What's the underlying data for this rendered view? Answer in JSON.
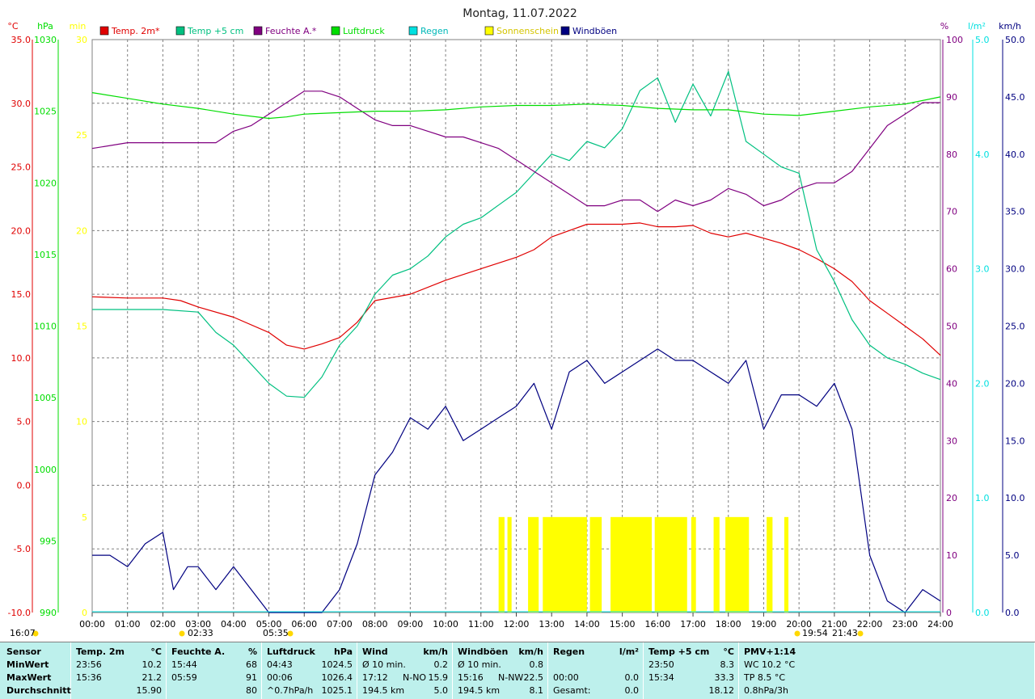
{
  "title": "Montag, 11.07.2022",
  "colors": {
    "temp": "#e00000",
    "temp5": "#00c080",
    "humidity": "#800080",
    "pressure": "#00dd00",
    "rain": "#00e0e0",
    "sun": "#ffff00",
    "gust": "#000080"
  },
  "axis_units": {
    "temp": "°C",
    "pressure": "hPa",
    "sun": "min",
    "humidity": "%",
    "rain": "l/m²",
    "wind": "km/h"
  },
  "legend": [
    {
      "label": "Temp. 2m*",
      "color": "#e00000"
    },
    {
      "label": "Temp +5 cm",
      "color": "#00c080"
    },
    {
      "label": "Feuchte A.*",
      "color": "#800080"
    },
    {
      "label": "Luftdruck",
      "color": "#00dd00"
    },
    {
      "label": "Regen",
      "color": "#00e0e0"
    },
    {
      "label": "Sonnenschein",
      "color": "#ffff00"
    },
    {
      "label": "Windböen",
      "color": "#000080"
    }
  ],
  "marks": {
    "sunrise": "05:35",
    "sunset": "21:43",
    "moonrise": "16:07",
    "moon_a": "02:33",
    "moon_b": "19:54"
  },
  "chart_data": {
    "type": "line",
    "x_label_ticks": [
      "00:00",
      "01:00",
      "02:00",
      "03:00",
      "04:00",
      "05:00",
      "06:00",
      "07:00",
      "08:00",
      "09:00",
      "10:00",
      "11:00",
      "12:00",
      "13:00",
      "14:00",
      "15:00",
      "16:00",
      "17:00",
      "18:00",
      "19:00",
      "20:00",
      "21:00",
      "22:00",
      "23:00",
      "24:00"
    ],
    "axes": {
      "temp": {
        "ticks": [
          "35.0",
          "30.0",
          "25.0",
          "20.0",
          "15.0",
          "10.0",
          "5.0",
          "0.0",
          "-5.0",
          "-10.0"
        ],
        "range": [
          -10,
          35
        ]
      },
      "pressure": {
        "ticks": [
          "1030",
          "1025",
          "1020",
          "1015",
          "1010",
          "1005",
          "1000",
          "995",
          "990"
        ],
        "range": [
          990,
          1030
        ]
      },
      "sun": {
        "ticks": [
          "30",
          "25",
          "20",
          "15",
          "10",
          "5",
          "0"
        ],
        "range": [
          0,
          30
        ]
      },
      "humidity": {
        "ticks": [
          "100",
          "90",
          "80",
          "70",
          "60",
          "50",
          "40",
          "30",
          "20",
          "10",
          "0"
        ],
        "range": [
          0,
          100
        ]
      },
      "rain": {
        "ticks": [
          "5.0",
          "4.0",
          "3.0",
          "2.0",
          "1.0",
          "0.0"
        ],
        "range": [
          0,
          5
        ]
      },
      "wind": {
        "ticks": [
          "50.0",
          "45.0",
          "40.0",
          "35.0",
          "30.0",
          "25.0",
          "20.0",
          "15.0",
          "10.0",
          "5.0",
          "0.0"
        ],
        "range": [
          0,
          50
        ]
      }
    },
    "series": [
      {
        "name": "Temp. 2m*",
        "unit": "°C",
        "x": [
          0,
          1,
          2,
          2.5,
          3,
          4,
          5,
          5.5,
          6,
          6.5,
          7,
          7.5,
          8,
          9,
          10,
          11,
          12,
          12.5,
          13,
          13.5,
          14,
          14.5,
          15,
          15.5,
          16,
          16.5,
          17,
          17.5,
          18,
          18.5,
          19,
          19.5,
          20,
          20.5,
          21,
          21.5,
          22,
          22.5,
          23,
          23.5,
          24
        ],
        "y": [
          14.8,
          14.7,
          14.7,
          14.5,
          14.0,
          13.2,
          12.0,
          11.0,
          10.7,
          11.1,
          11.6,
          12.8,
          14.5,
          15.0,
          16.1,
          17.0,
          17.9,
          18.5,
          19.5,
          20.0,
          20.5,
          20.5,
          20.5,
          20.6,
          20.3,
          20.3,
          20.4,
          19.8,
          19.5,
          19.8,
          19.4,
          19.0,
          18.5,
          17.8,
          17.0,
          16.0,
          14.5,
          13.5,
          12.5,
          11.5,
          10.2
        ]
      },
      {
        "name": "Temp +5 cm",
        "unit": "°C",
        "x": [
          0,
          1,
          2,
          3,
          3.5,
          4,
          4.5,
          5,
          5.5,
          6,
          6.5,
          7,
          7.5,
          8,
          8.5,
          9,
          9.5,
          10,
          10.5,
          11,
          11.5,
          12,
          12.5,
          13,
          13.5,
          14,
          14.5,
          15,
          15.5,
          16,
          16.5,
          17,
          17.5,
          18,
          18.5,
          19,
          19.5,
          20,
          20.5,
          21,
          21.5,
          22,
          22.5,
          23,
          23.5,
          24
        ],
        "y": [
          13.8,
          13.8,
          13.8,
          13.6,
          12.0,
          11.0,
          9.5,
          8.0,
          7.0,
          6.9,
          8.5,
          11.0,
          12.5,
          15.0,
          16.5,
          17.0,
          18.0,
          19.5,
          20.5,
          21.0,
          22.0,
          23.0,
          24.5,
          26.0,
          25.5,
          27.0,
          26.5,
          28.0,
          31.0,
          32.0,
          28.5,
          31.5,
          29.0,
          32.5,
          27.0,
          26.0,
          25.0,
          24.5,
          18.5,
          16.0,
          13.0,
          11.0,
          10.0,
          9.5,
          8.8,
          8.3
        ]
      },
      {
        "name": "Feuchte A.*",
        "unit": "%",
        "x": [
          0,
          1,
          1.5,
          2,
          3,
          3.5,
          4,
          4.5,
          5,
          5.5,
          6,
          6.5,
          7,
          7.5,
          8,
          8.5,
          9,
          9.5,
          10,
          10.5,
          11,
          11.5,
          12,
          12.5,
          13,
          13.5,
          14,
          14.5,
          15,
          15.5,
          16,
          16.5,
          17,
          17.5,
          18,
          18.5,
          19,
          19.5,
          20,
          20.5,
          21,
          21.5,
          22,
          22.5,
          23,
          23.5,
          24
        ],
        "y": [
          81,
          82,
          82,
          82,
          82,
          82,
          84,
          85,
          87,
          89,
          91,
          91,
          90,
          88,
          86,
          85,
          85,
          84,
          83,
          83,
          82,
          81,
          79,
          77,
          75,
          73,
          71,
          71,
          72,
          72,
          70,
          72,
          71,
          72,
          74,
          73,
          71,
          72,
          74,
          75,
          75,
          77,
          81,
          85,
          87,
          89,
          89
        ]
      },
      {
        "name": "Luftdruck",
        "unit": "hPa",
        "x": [
          0,
          1,
          2,
          3,
          4,
          5,
          5.5,
          6,
          7,
          8,
          9,
          10,
          11,
          12,
          13,
          14,
          15,
          16,
          17,
          18,
          19,
          20,
          21,
          22,
          23,
          24
        ],
        "y": [
          1026.3,
          1025.9,
          1025.5,
          1025.2,
          1024.8,
          1024.5,
          1024.6,
          1024.8,
          1024.9,
          1025.0,
          1025.0,
          1025.1,
          1025.3,
          1025.4,
          1025.4,
          1025.5,
          1025.4,
          1025.2,
          1025.1,
          1025.1,
          1024.8,
          1024.7,
          1025.0,
          1025.3,
          1025.5,
          1026.0
        ]
      },
      {
        "name": "Windböen",
        "unit": "km/h",
        "x": [
          0,
          0.5,
          1,
          1.5,
          2,
          2.3,
          2.7,
          3,
          3.5,
          4,
          4.5,
          5,
          5.5,
          6,
          6.5,
          7,
          7.5,
          8,
          8.5,
          9,
          9.5,
          10,
          10.5,
          11,
          11.5,
          12,
          12.5,
          13,
          13.5,
          14,
          14.5,
          15,
          15.5,
          16,
          16.5,
          17,
          17.5,
          18,
          18.5,
          19,
          19.5,
          20,
          20.5,
          21,
          21.5,
          22,
          22.5,
          23,
          23.5,
          24
        ],
        "y": [
          5,
          5,
          4,
          6,
          7,
          2,
          4,
          4,
          2,
          4,
          2,
          0,
          0,
          0,
          0,
          2,
          6,
          12,
          14,
          17,
          16,
          18,
          15,
          16,
          17,
          18,
          20,
          16,
          21,
          22,
          20,
          21,
          22,
          23,
          22,
          22,
          21,
          20,
          22,
          16,
          19,
          19,
          18,
          20,
          16,
          5,
          1,
          0,
          2,
          1
        ]
      }
    ],
    "sunshine_intervals": [
      [
        "11:30",
        "11:40"
      ],
      [
        "11:45",
        "11:52"
      ],
      [
        "12:20",
        "12:38"
      ],
      [
        "12:45",
        "14:00"
      ],
      [
        "14:05",
        "14:25"
      ],
      [
        "14:40",
        "15:50"
      ],
      [
        "15:55",
        "16:50"
      ],
      [
        "16:57",
        "17:05"
      ],
      [
        "17:35",
        "17:45"
      ],
      [
        "17:55",
        "18:35"
      ],
      [
        "19:05",
        "19:15"
      ],
      [
        "19:35",
        "19:42"
      ]
    ],
    "rain": {
      "values": [
        0
      ]
    }
  },
  "table": {
    "row_labels": [
      "Sensor",
      "MinWert",
      "MaxWert",
      "Durchschnitt"
    ],
    "sections": [
      {
        "header": "Temp. 2m",
        "unit": "°C",
        "rows": [
          [
            "23:56",
            "",
            "10.2"
          ],
          [
            "15:36",
            "",
            "21.2"
          ],
          [
            "",
            "",
            "15.90"
          ]
        ]
      },
      {
        "header": "Feuchte A.",
        "unit": "%",
        "rows": [
          [
            "15:44",
            "",
            "68"
          ],
          [
            "05:59",
            "",
            "91"
          ],
          [
            "",
            "",
            "80"
          ]
        ]
      },
      {
        "header": "Luftdruck",
        "unit": "hPa",
        "rows": [
          [
            "04:43",
            "",
            "1024.5"
          ],
          [
            "00:06",
            "",
            "1026.4"
          ],
          [
            "^0.7hPa/h",
            "",
            "1025.1"
          ]
        ]
      },
      {
        "header": "Wind",
        "unit": "km/h",
        "rows": [
          [
            "Ø 10 min.",
            "",
            "0.2"
          ],
          [
            "17:12",
            "N-NO",
            "15.9"
          ],
          [
            "194.5 km",
            "",
            "5.0"
          ]
        ]
      },
      {
        "header": "Windböen",
        "unit": "km/h",
        "rows": [
          [
            "Ø 10 min.",
            "",
            "0.8"
          ],
          [
            "15:16",
            "N-NW",
            "22.5"
          ],
          [
            "194.5 km",
            "",
            "8.1"
          ]
        ]
      },
      {
        "header": "Regen",
        "unit": "l/m²",
        "rows": [
          [
            "",
            "",
            ""
          ],
          [
            "00:00",
            "",
            "0.0"
          ],
          [
            "Gesamt:",
            "",
            "0.0"
          ]
        ]
      },
      {
        "header": "Temp +5 cm",
        "unit": "°C",
        "rows": [
          [
            "23:50",
            "",
            "8.3"
          ],
          [
            "15:34",
            "",
            "33.3"
          ],
          [
            "",
            "",
            "18.12"
          ]
        ]
      },
      {
        "header": "PMV+1:14",
        "unit": "",
        "rows": [
          [
            "WC 10.2 °C",
            "",
            ""
          ],
          [
            "TP 8.5 °C",
            "",
            ""
          ],
          [
            "0.8hPa/3h",
            "",
            ""
          ]
        ]
      }
    ]
  }
}
